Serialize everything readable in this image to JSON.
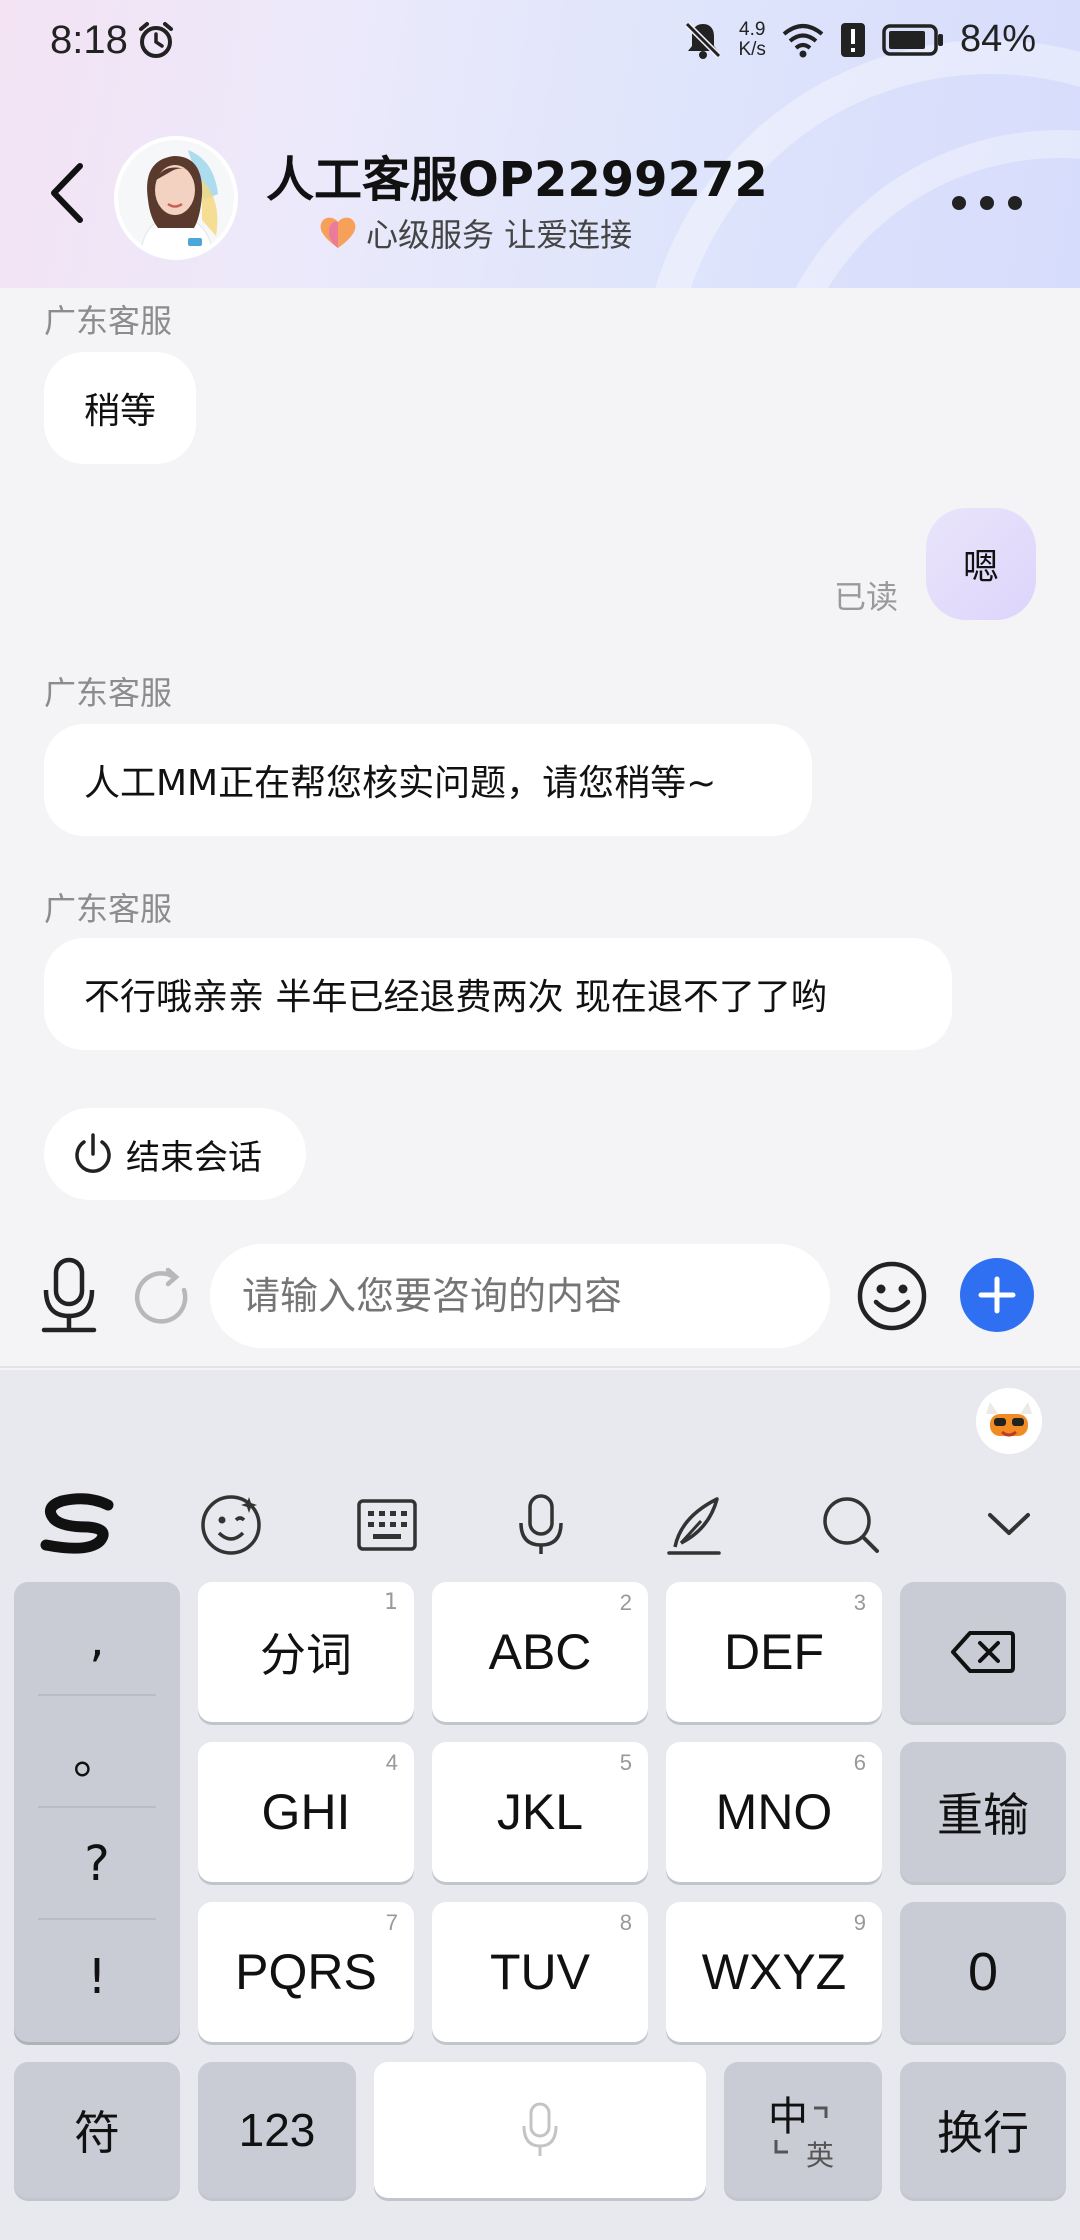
{
  "status_bar": {
    "time": "8:18",
    "net_speed_value": "4.9",
    "net_speed_unit": "K/s",
    "battery": "84%"
  },
  "header": {
    "title": "人工客服OP2299272",
    "subtitle": "心级服务 让爱连接"
  },
  "messages": [
    {
      "sender": "广东客服",
      "text": "稍等",
      "from": "agent"
    },
    {
      "text": "嗯",
      "from": "me",
      "status": "已读"
    },
    {
      "sender": "广东客服",
      "text": "人工MM正在帮您核实问题，请您稍等~",
      "from": "agent"
    },
    {
      "sender": "广东客服",
      "text": "不行哦亲亲 半年已经退费两次  现在退不了了哟",
      "from": "agent"
    }
  ],
  "end_chat": {
    "label": "结束会话"
  },
  "input": {
    "placeholder": "请输入您要咨询的内容"
  },
  "keyboard": {
    "punct": [
      ",",
      "。",
      "?",
      "!"
    ],
    "keys": [
      {
        "label": "分词",
        "num": "1"
      },
      {
        "label": "ABC",
        "num": "2"
      },
      {
        "label": "DEF",
        "num": "3"
      },
      {
        "label": "GHI",
        "num": "4"
      },
      {
        "label": "JKL",
        "num": "5"
      },
      {
        "label": "MNO",
        "num": "6"
      },
      {
        "label": "PQRS",
        "num": "7"
      },
      {
        "label": "TUV",
        "num": "8"
      },
      {
        "label": "WXYZ",
        "num": "9"
      }
    ],
    "reenter": "重输",
    "zero": "0",
    "symbols": "符",
    "numbers": "123",
    "lang_main": "中",
    "lang_alt": "英",
    "enter": "换行"
  }
}
